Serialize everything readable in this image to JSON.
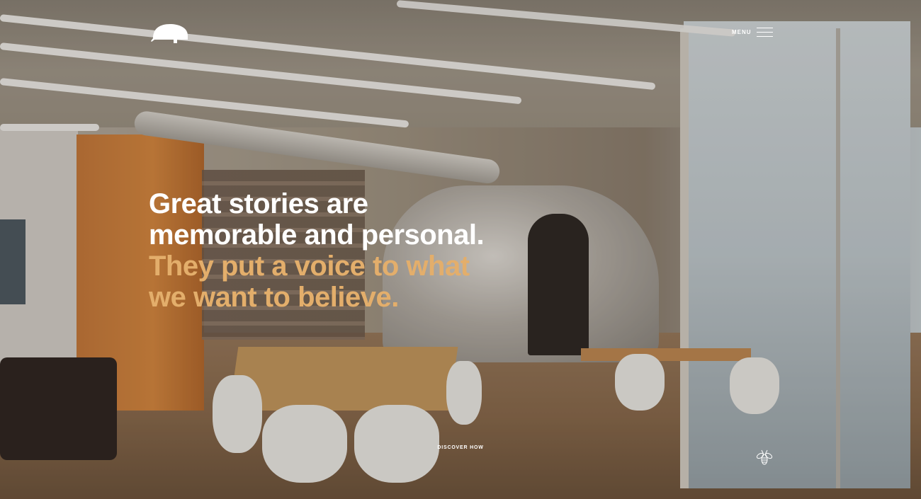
{
  "header": {
    "logo_icon": "trailer-logo-icon",
    "menu_label": "MENU",
    "menu_icon": "hamburger-menu-icon"
  },
  "hero": {
    "headline_white": [
      "Great stories are",
      "memorable and personal."
    ],
    "headline_gold": [
      "They put a voice to what",
      "we want to believe."
    ],
    "cta_label": "DISCOVER HOW",
    "badge_icon": "bee-icon"
  },
  "colors": {
    "headline_primary": "#ffffff",
    "headline_accent": "#e3ae6b"
  }
}
